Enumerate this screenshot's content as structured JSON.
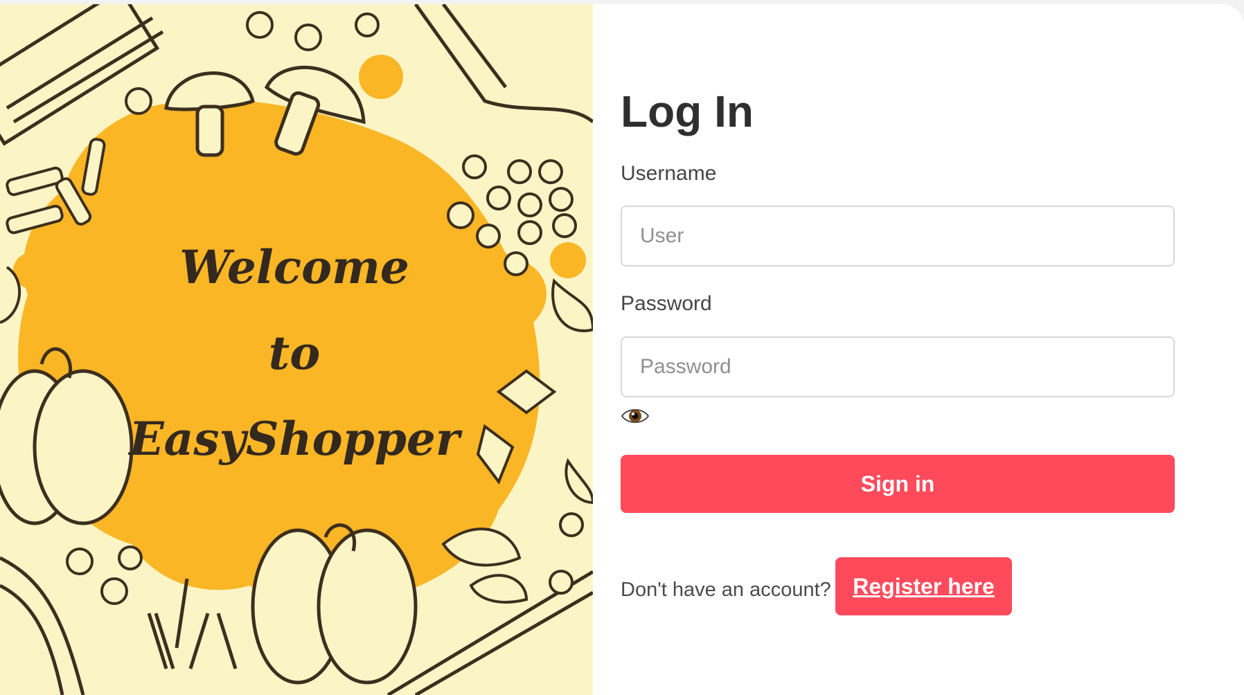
{
  "hero": {
    "welcome_line1": "Welcome",
    "welcome_line2": "to",
    "welcome_line3": "EasyShopper"
  },
  "login": {
    "title": "Log In",
    "username_label": "Username",
    "username_placeholder": "User",
    "password_label": "Password",
    "password_placeholder": "Password",
    "toggle_icon": "eye-icon",
    "signin_label": "Sign in",
    "no_account_text": "Don't have an account?",
    "register_label": "Register here"
  },
  "colors": {
    "accent": "#ff4a5c",
    "hero_background": "#fbf5c6",
    "hero_blob": "#fbb626",
    "ink": "#3d2f1e"
  }
}
